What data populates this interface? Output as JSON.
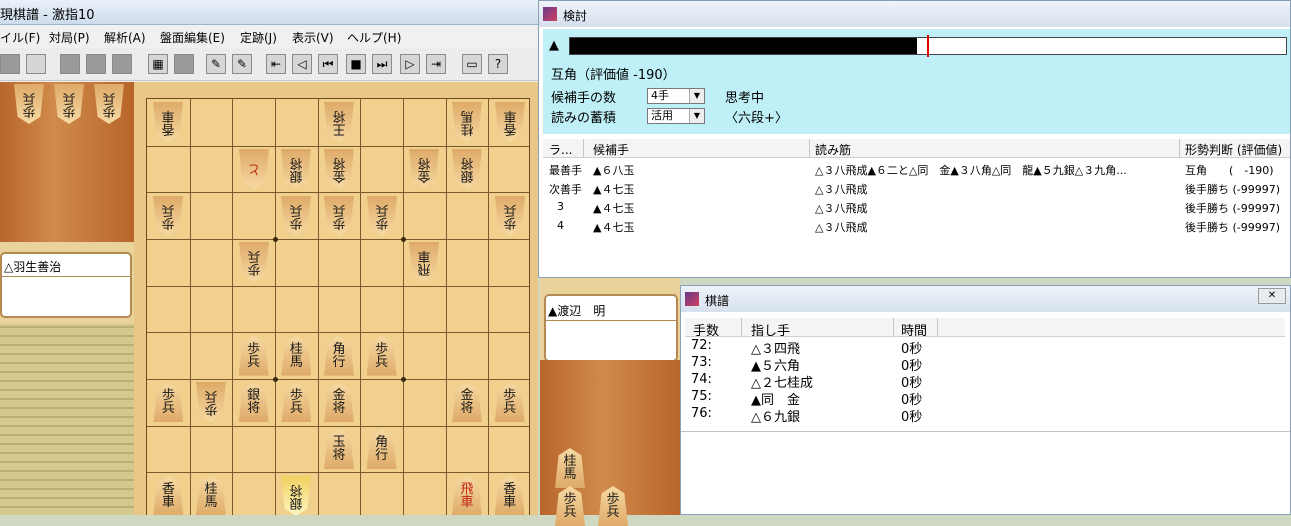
{
  "main_window": {
    "title": "現棋譜 - 激指10",
    "menu": [
      "イル(F)",
      "対局(P)",
      "解析(A)",
      "盤面編集(E)",
      "定跡(J)",
      "表示(V)",
      "ヘルプ(H)"
    ],
    "gote_player": "△羽生善治",
    "sente_player": "▲渡辺　明"
  },
  "analysis_window": {
    "title": "検討",
    "bar_marker": "▲",
    "eval_fraction": 0.485,
    "status_line": "互角（評価値 -190）",
    "candidates_label": "候補手の数",
    "candidates_value": "4手",
    "thinking": "思考中",
    "accum_label": "読みの蓄積",
    "accum_value": "活用",
    "rank_label": "〈六段+〉",
    "columns": [
      "ラ...",
      "候補手",
      "読み筋",
      "形勢判断 (評価値)"
    ],
    "rows": [
      {
        "rank": "最善手",
        "move": "▲６八玉",
        "line": "△３八飛成▲６二と△同　金▲３八角△同　龍▲５九銀△３九角...",
        "judge": "互角　　(　-190)"
      },
      {
        "rank": "次善手",
        "move": "▲４七玉",
        "line": "△３八飛成",
        "judge": "後手勝ち (-99997)"
      },
      {
        "rank": "3",
        "move": "▲４七玉",
        "line": "△３八飛成",
        "judge": "後手勝ち (-99997)"
      },
      {
        "rank": "4",
        "move": "▲４七玉",
        "line": "△３八飛成",
        "judge": "後手勝ち (-99997)"
      }
    ]
  },
  "kifu_window": {
    "title": "棋譜",
    "columns": [
      "手数",
      "指し手",
      "時間"
    ],
    "rows": [
      {
        "num": "72:",
        "move": "△３四飛",
        "time": "0秒"
      },
      {
        "num": "73:",
        "move": "▲５六角",
        "time": "0秒"
      },
      {
        "num": "74:",
        "move": "△２七桂成",
        "time": "0秒"
      },
      {
        "num": "75:",
        "move": "▲同　金",
        "time": "0秒"
      },
      {
        "num": "76:",
        "move": "△６九銀",
        "time": "0秒"
      }
    ]
  },
  "board": {
    "pieces": [
      {
        "f": 9,
        "r": 1,
        "p": "香車",
        "g": true
      },
      {
        "f": 5,
        "r": 1,
        "p": "王将",
        "g": true
      },
      {
        "f": 2,
        "r": 1,
        "p": "桂馬",
        "g": true
      },
      {
        "f": 1,
        "r": 1,
        "p": "香車",
        "g": true
      },
      {
        "f": 7,
        "r": 2,
        "p": "と",
        "g": true,
        "red": true
      },
      {
        "f": 6,
        "r": 2,
        "p": "銀将",
        "g": true
      },
      {
        "f": 5,
        "r": 2,
        "p": "金将",
        "g": true
      },
      {
        "f": 3,
        "r": 2,
        "p": "金将",
        "g": true
      },
      {
        "f": 2,
        "r": 2,
        "p": "銀将",
        "g": true
      },
      {
        "f": 9,
        "r": 3,
        "p": "歩兵",
        "g": true
      },
      {
        "f": 6,
        "r": 3,
        "p": "歩兵",
        "g": true
      },
      {
        "f": 5,
        "r": 3,
        "p": "歩兵",
        "g": true
      },
      {
        "f": 4,
        "r": 3,
        "p": "歩兵",
        "g": true
      },
      {
        "f": 1,
        "r": 3,
        "p": "歩兵",
        "g": true
      },
      {
        "f": 7,
        "r": 4,
        "p": "歩兵",
        "g": true
      },
      {
        "f": 3,
        "r": 4,
        "p": "飛車",
        "g": true
      },
      {
        "f": 7,
        "r": 6,
        "p": "歩兵"
      },
      {
        "f": 6,
        "r": 6,
        "p": "桂馬"
      },
      {
        "f": 5,
        "r": 6,
        "p": "角行"
      },
      {
        "f": 4,
        "r": 6,
        "p": "歩兵"
      },
      {
        "f": 9,
        "r": 7,
        "p": "歩兵"
      },
      {
        "f": 8,
        "r": 7,
        "p": "歩兵",
        "g": true
      },
      {
        "f": 7,
        "r": 7,
        "p": "銀将"
      },
      {
        "f": 6,
        "r": 7,
        "p": "歩兵"
      },
      {
        "f": 5,
        "r": 7,
        "p": "金将"
      },
      {
        "f": 2,
        "r": 7,
        "p": "金将"
      },
      {
        "f": 1,
        "r": 7,
        "p": "歩兵"
      },
      {
        "f": 5,
        "r": 8,
        "p": "玉将"
      },
      {
        "f": 4,
        "r": 8,
        "p": "角行"
      },
      {
        "f": 9,
        "r": 9,
        "p": "香車"
      },
      {
        "f": 8,
        "r": 9,
        "p": "桂馬"
      },
      {
        "f": 6,
        "r": 9,
        "p": "銀将",
        "g": true,
        "hl": true
      },
      {
        "f": 2,
        "r": 9,
        "p": "飛車",
        "red": true
      },
      {
        "f": 1,
        "r": 9,
        "p": "香車"
      }
    ],
    "gote_hand": [
      "歩兵",
      "歩兵",
      "歩兵"
    ],
    "sente_hand": [
      "桂馬",
      "歩兵",
      "歩兵"
    ]
  }
}
